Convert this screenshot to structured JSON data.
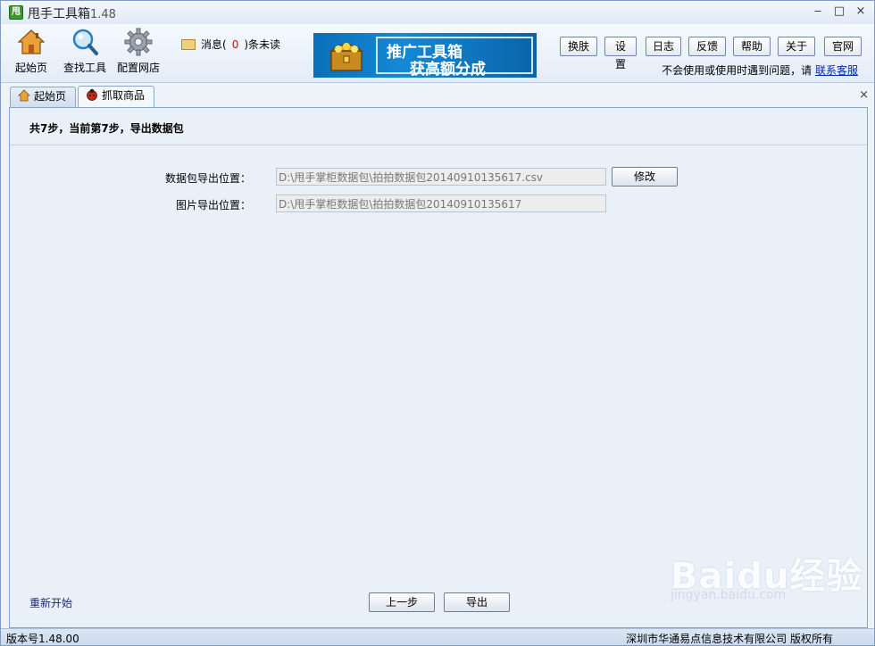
{
  "window": {
    "logo_text": "甩",
    "title": "甩手工具箱",
    "version": "1.48",
    "controls": {
      "minimize": "‒",
      "maximize": "□",
      "close": "×"
    }
  },
  "toolbar": {
    "home_label": "起始页",
    "find_tools_label": "查找工具",
    "config_shop_label": "配置网店",
    "message_prefix": "消息(",
    "message_count": "0",
    "message_suffix": ")条未读",
    "banner_line1": "推广工具箱",
    "banner_line2": "获高额分成",
    "buttons": [
      "换肤",
      "设置",
      "日志",
      "反馈",
      "帮助",
      "关于",
      "官网"
    ],
    "help_text": "不会使用或使用时遇到问题，请",
    "help_link": "联系客服"
  },
  "tabs": [
    {
      "label": "起始页",
      "icon": "home-icon"
    },
    {
      "label": "抓取商品",
      "icon": "ladybug-icon"
    }
  ],
  "content": {
    "step_text": "共7步，当前第7步，导出数据包",
    "datapack_label": "数据包导出位置：",
    "datapack_value": "D:\\甩手掌柜数据包\\拍拍数据包20140910135617.csv",
    "modify_button": "修改",
    "image_label": "图片导出位置：",
    "image_value": "D:\\甩手掌柜数据包\\拍拍数据包20140910135617",
    "restart_link": "重新开始",
    "prev_button": "上一步",
    "export_button": "导出"
  },
  "status": {
    "version": "版本号1.48.00",
    "copyright": "深圳市华通易点信息技术有限公司  版权所有"
  },
  "watermark": {
    "logo": "Baidu经验",
    "url": "jingyan.baidu.com"
  },
  "colors": {
    "accent": "#0a6fb9",
    "link": "#0026b3",
    "unread_count": "#e00000"
  }
}
